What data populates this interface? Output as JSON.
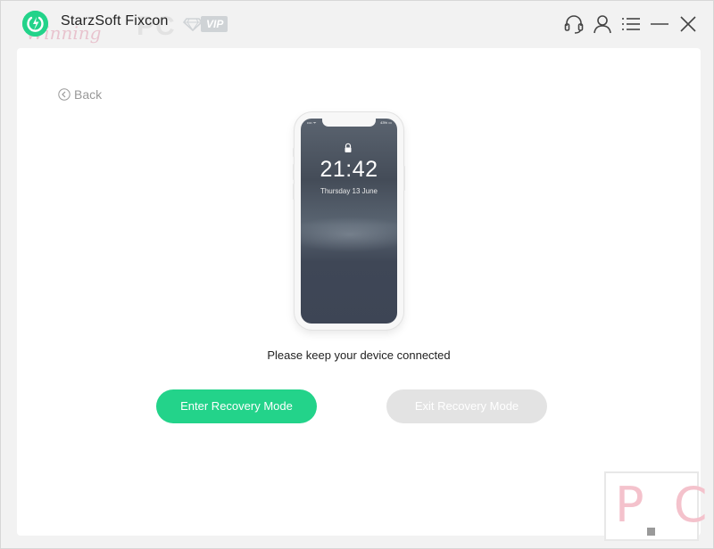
{
  "titlebar": {
    "app_title": "StarzSoft Fixcon",
    "vip_label": "VIP",
    "watermark_script": "Winning",
    "watermark_pc": "PC",
    "icons": [
      "headset-icon",
      "user-icon",
      "menu-icon",
      "minimize-icon",
      "close-icon"
    ]
  },
  "main": {
    "back_label": "Back",
    "phone": {
      "time": "21:42",
      "date": "Thursday 13 June",
      "status_left": "•••• ᯤ",
      "status_right": "43% ▭"
    },
    "message": "Please keep your device connected",
    "enter_button": "Enter Recovery Mode",
    "exit_button": "Exit Recovery Mode"
  },
  "stamp": {
    "text": "P C"
  },
  "colors": {
    "accent": "#23d38a",
    "disabled": "#e3e3e3",
    "background": "#f2f2f2",
    "panel": "#ffffff"
  }
}
